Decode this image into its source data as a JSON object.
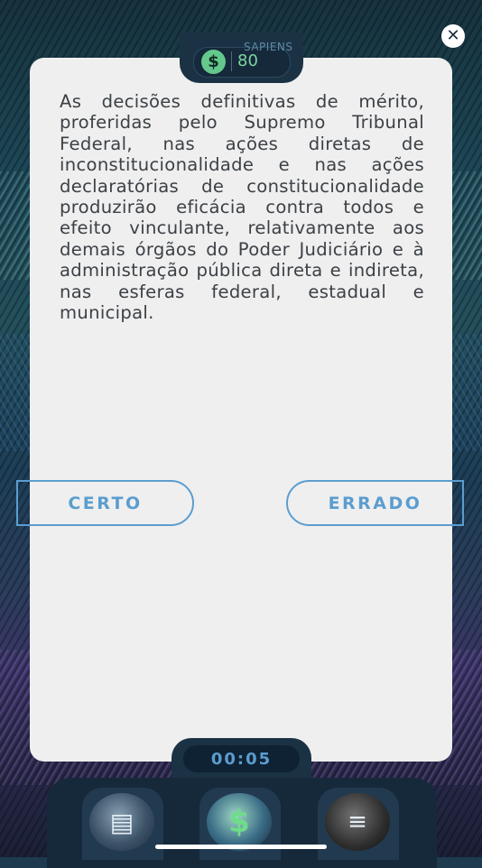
{
  "header": {
    "score_label": "SAPIENS",
    "score_value": "80",
    "coin_symbol": "$",
    "close_symbol": "✕"
  },
  "question": {
    "text": "As decisões definitivas de mérito, proferidas pelo Supremo Tribunal Federal, nas ações diretas de inconstitucionalidade e nas ações declaratórias de constitucionalidade produzirão eficácia contra todos e efeito vinculante, relativamente aos demais órgãos do Poder Judiciário e à administração pública direta e indireta, nas esferas federal, estadual e municipal."
  },
  "answers": {
    "certo": "CERTO",
    "errado": "ERRADO"
  },
  "timer": {
    "value": "00:05"
  },
  "tools": [
    {
      "name": "skip-cards",
      "glyph": "▤"
    },
    {
      "name": "money",
      "glyph": "$"
    },
    {
      "name": "stairs",
      "glyph": "≡"
    }
  ],
  "colors": {
    "accent": "#5b9dcf",
    "coin": "#64c88c",
    "card": "#efefef"
  }
}
